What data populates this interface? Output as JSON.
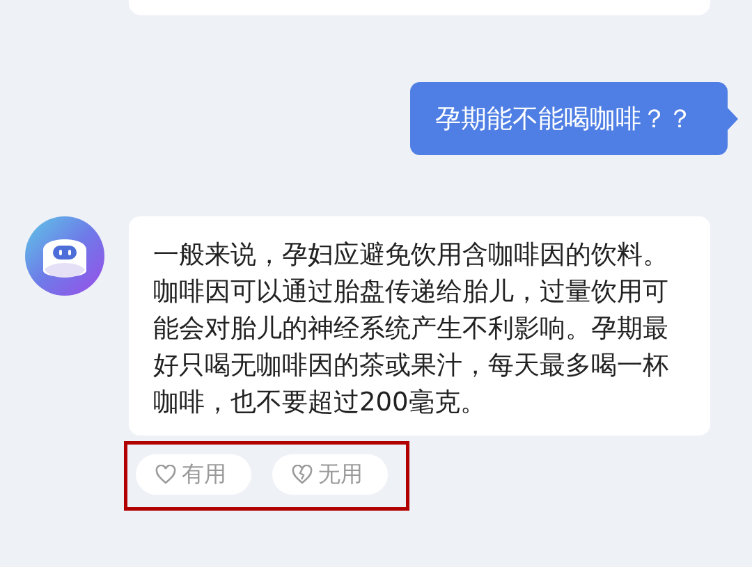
{
  "messages": [
    {
      "kind": "partial"
    },
    {
      "kind": "user",
      "text": "孕期能不能喝咖啡？？"
    },
    {
      "kind": "bot",
      "text": "一般来说，孕妇应避免饮用含咖啡因的饮料。咖啡因可以通过胎盘传递给胎儿，过量饮用可能会对胎儿的神经系统产生不利影响。孕期最好只喝无咖啡因的茶或果汁，每天最多喝一杯咖啡，也不要超过200毫克。"
    }
  ],
  "feedback": {
    "highlighted": true,
    "buttons": [
      {
        "kind": "like",
        "label": "有用"
      },
      {
        "kind": "dislike",
        "label": "无用"
      }
    ]
  }
}
